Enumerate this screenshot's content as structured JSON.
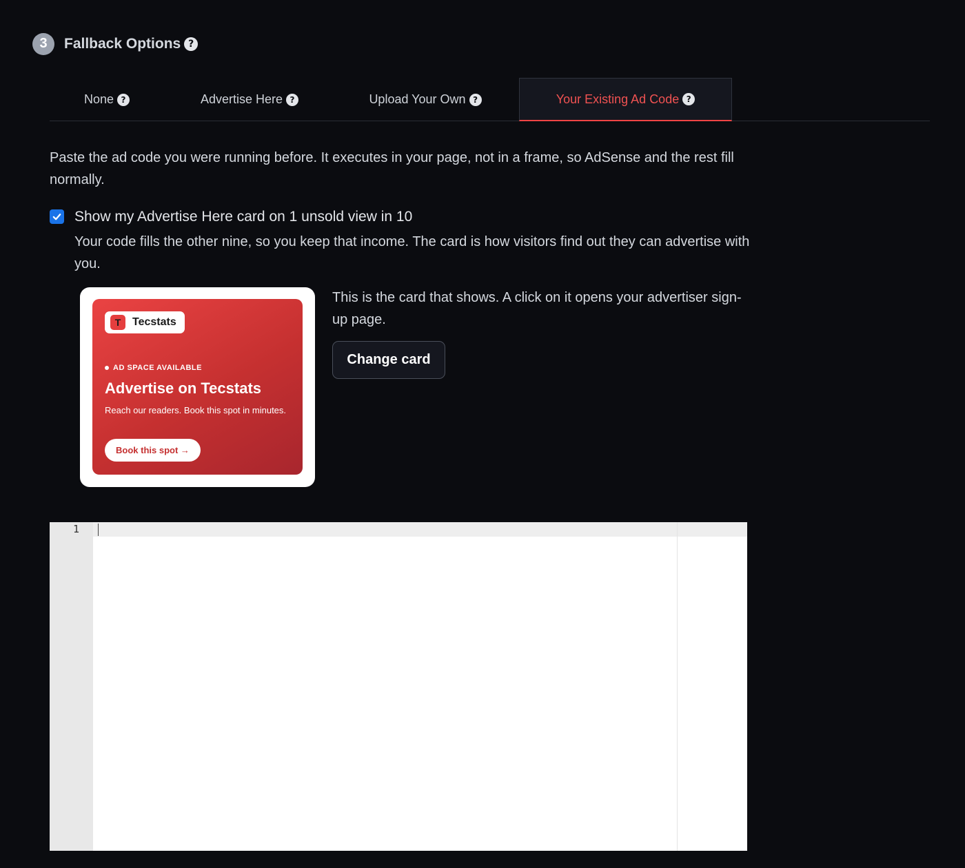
{
  "section": {
    "step": "3",
    "title": "Fallback Options",
    "help_icon": "?"
  },
  "tabs": [
    {
      "label": "None",
      "help_icon": "?",
      "active": false
    },
    {
      "label": "Advertise Here",
      "help_icon": "?",
      "active": false
    },
    {
      "label": "Upload Your Own",
      "help_icon": "?",
      "active": false
    },
    {
      "label": "Your Existing Ad Code",
      "help_icon": "?",
      "active": true
    }
  ],
  "intro_text": "Paste the ad code you were running before. It executes in your page, not in a frame, so AdSense and the rest fill normally.",
  "checkbox": {
    "checked": true,
    "label": "Show my Advertise Here card on 1 unsold view in 10",
    "help": "Your code fills the other nine, so you keep that income. The card is how visitors find out they can advertise with you."
  },
  "ad_card": {
    "brand_initial": "T",
    "brand_name": "Tecstats",
    "eyebrow": "AD SPACE AVAILABLE",
    "headline": "Advertise on Tecstats",
    "subtext": "Reach our readers. Book this spot in minutes.",
    "cta": "Book this spot →"
  },
  "card_note": "This is the card that shows. A click on it opens your advertiser sign-up page.",
  "change_card_label": "Change card",
  "editor": {
    "line_numbers": [
      "1"
    ],
    "content": ""
  },
  "colors": {
    "background": "#0b0c10",
    "accent": "#ef4444",
    "checkbox": "#1a73e8"
  }
}
